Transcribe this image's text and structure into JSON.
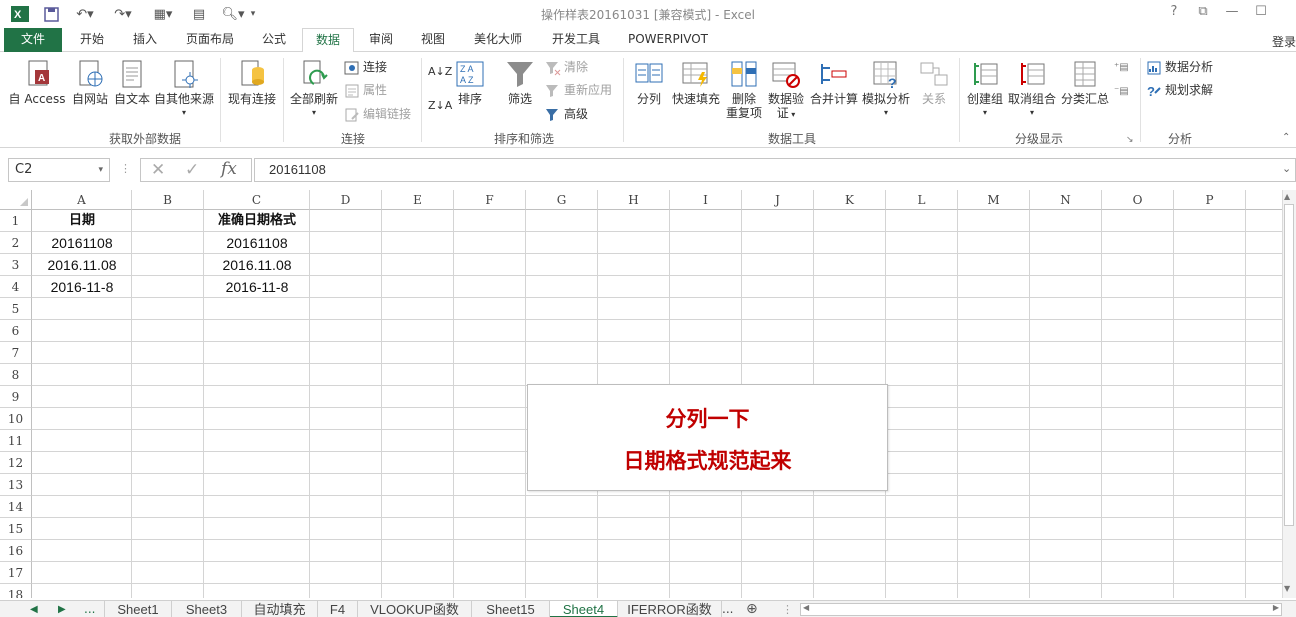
{
  "titlebar": {
    "title": "操作样表20161031  [兼容模式] - Excel",
    "help": "?",
    "restore": "⧉",
    "minimize": "—",
    "maximize": "☐"
  },
  "ribbon_tabs": [
    "文件",
    "开始",
    "插入",
    "页面布局",
    "公式",
    "数据",
    "审阅",
    "视图",
    "美化大师",
    "开发工具",
    "POWERPIVOT"
  ],
  "active_tab": "数据",
  "login": "登录",
  "groups": {
    "external": {
      "label": "获取外部数据",
      "access": "自 Access",
      "web": "自网站",
      "text": "自文本",
      "other": "自其他来源",
      "existing": "现有连接"
    },
    "connections": {
      "label": "连接",
      "refresh": "全部刷新",
      "connections": "连接",
      "properties": "属性",
      "edit_links": "编辑链接"
    },
    "sort_filter": {
      "label": "排序和筛选",
      "sort": "排序",
      "filter": "筛选",
      "clear": "清除",
      "reapply": "重新应用",
      "advanced": "高级"
    },
    "data_tools": {
      "label": "数据工具",
      "split": "分列",
      "flash_fill": "快速填充",
      "remove_dup_1": "删除",
      "remove_dup_2": "重复项",
      "validation_1": "数据验",
      "validation_2": "证",
      "consolidate": "合并计算",
      "what_if": "模拟分析",
      "relations": "关系"
    },
    "outline": {
      "label": "分级显示",
      "group": "创建组",
      "ungroup": "取消组合",
      "subtotal": "分类汇总"
    },
    "analysis": {
      "label": "分析",
      "data_analysis": "数据分析",
      "solver": "规划求解"
    }
  },
  "formula_bar": {
    "name_box": "C2",
    "formula": "20161108",
    "fx": "fx"
  },
  "columns": [
    "A",
    "B",
    "C",
    "D",
    "E",
    "F",
    "G",
    "H",
    "I",
    "J",
    "K",
    "L",
    "M",
    "N",
    "O",
    "P"
  ],
  "rows": [
    "1",
    "2",
    "3",
    "4",
    "5",
    "6",
    "7",
    "8",
    "9",
    "10",
    "11",
    "12",
    "13",
    "14",
    "15",
    "16",
    "17",
    "18"
  ],
  "cells": {
    "A1": "日期",
    "C1": "准确日期格式",
    "A2": "20161108",
    "C2": "20161108",
    "A3": "2016.11.08",
    "C3": "2016.11.08",
    "A4": "2016-11-8",
    "C4": "2016-11-8"
  },
  "callout": {
    "line1": "分列一下",
    "line2": "日期格式规范起来"
  },
  "sheet_tabs": [
    "Sheet1",
    "Sheet3",
    "自动填充",
    "F4",
    "VLOOKUP函数",
    "Sheet15",
    "Sheet4",
    "IFERROR函数"
  ],
  "active_sheet": "Sheet4",
  "colors": {
    "accent": "#217346",
    "callout_text": "#c00000"
  }
}
